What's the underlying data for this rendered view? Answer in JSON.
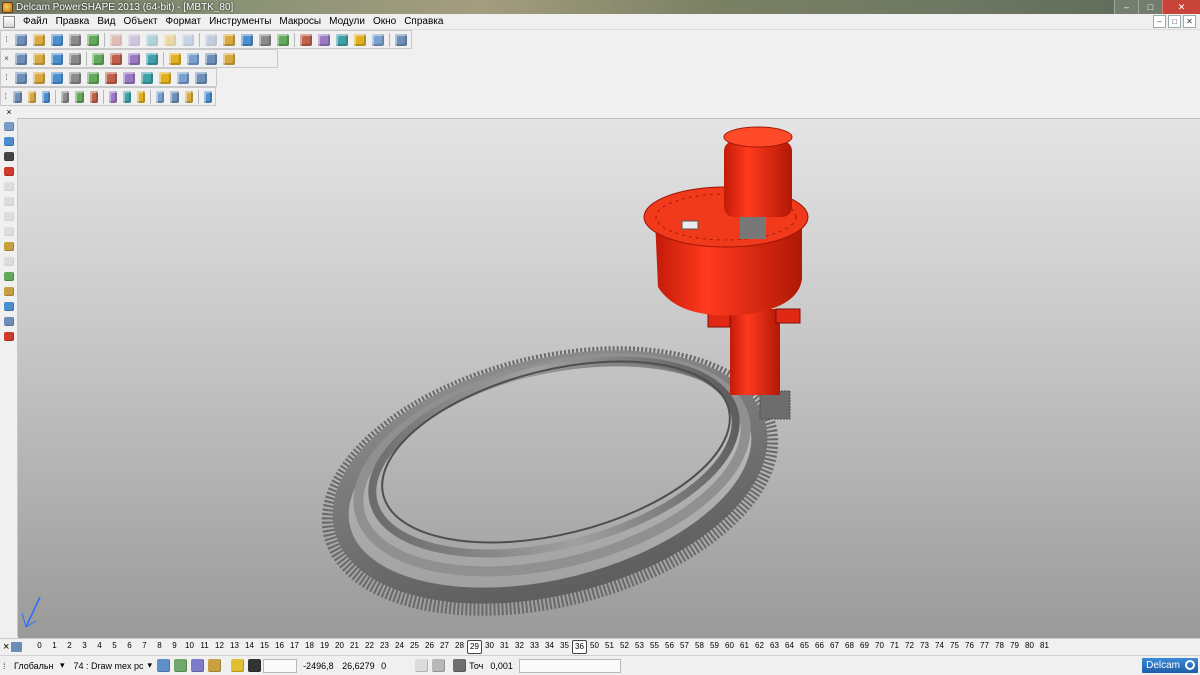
{
  "window": {
    "title": "Delcam PowerSHAPE 2013 (64-bit) - [MBTK_80]",
    "buttons": [
      "–",
      "□",
      "✕"
    ]
  },
  "menu": {
    "items": [
      "Файл",
      "Правка",
      "Вид",
      "Объект",
      "Формат",
      "Инструменты",
      "Макросы",
      "Модули",
      "Окно",
      "Справка"
    ],
    "mdi_buttons": [
      "–",
      "□",
      "✕"
    ]
  },
  "toolbars": {
    "close_glyph": "×",
    "row1_icons": [
      "new-icon",
      "open-icon",
      "save-icon",
      "save-as-icon",
      "print-icon",
      "cut-icon",
      "copy-icon",
      "paste-icon",
      "delete-icon",
      "undo-icon",
      "redo-icon",
      "measure-icon",
      "snap-icon",
      "axis-icon",
      "circle-icon",
      "arc-icon",
      "text-icon",
      "curve-icon",
      "surface-icon",
      "solid-icon",
      "tool-icon"
    ],
    "row2_icons": [
      "view-iso-icon",
      "view-front-icon",
      "view-top-icon",
      "view-3d-icon",
      "zoom-box-icon",
      "zoom-in-icon",
      "zoom-fit-icon",
      "rotate-icon",
      "pan-icon",
      "shade-icon",
      "light-icon",
      "hand-icon"
    ],
    "row3_icons": [
      "wireframe-icon",
      "surface-model-icon",
      "blue-solid-icon",
      "green-solid-icon",
      "red-solid-icon",
      "cone-icon",
      "cube-icon",
      "box-icon",
      "frame-icon",
      "cylinder-icon",
      "sphere-icon"
    ],
    "row4_icons": [
      "edit-icon",
      "transform-icon",
      "feature-icon",
      "pocket-icon",
      "boss-icon",
      "shell-icon",
      "blend-icon",
      "pattern-icon",
      "morph-icon",
      "split-icon",
      "draft-icon",
      "fillet-icon",
      "chamfer-icon"
    ]
  },
  "left_toolbar": {
    "icons": [
      "select-icon",
      "model-tree-icon",
      "point-icon",
      "warning-icon",
      "line-icon",
      "arc-tool-icon",
      "curve-tool-icon",
      "surface-tool-icon",
      "star-icon",
      "cone-tool-icon",
      "solid-tool-icon",
      "gear-icon",
      "assembly-icon",
      "layer-icon",
      "red-tool-icon"
    ]
  },
  "levels": {
    "numbers": [
      "0",
      "1",
      "2",
      "3",
      "4",
      "5",
      "6",
      "7",
      "8",
      "9",
      "10",
      "11",
      "12",
      "13",
      "14",
      "15",
      "16",
      "17",
      "18",
      "19",
      "20",
      "21",
      "22",
      "23",
      "24",
      "25",
      "26",
      "27",
      "28",
      "29",
      "30",
      "31",
      "32",
      "33",
      "34",
      "35",
      "36",
      "50",
      "51",
      "52",
      "53",
      "55",
      "56",
      "57",
      "58",
      "59",
      "60",
      "61",
      "62",
      "63",
      "64",
      "65",
      "66",
      "67",
      "68",
      "69",
      "70",
      "71",
      "72",
      "73",
      "74",
      "75",
      "76",
      "77",
      "78",
      "79",
      "80",
      "81"
    ],
    "active": [
      "29",
      "36"
    ]
  },
  "status": {
    "workplane": "Глобальн",
    "level": "74 : Draw mex pc",
    "x": "-2496,8",
    "y": "26,6279",
    "z": "0",
    "tolerance_label": "Точ",
    "tolerance": "0,001",
    "logo": "Delcam"
  },
  "colors": {
    "accent_red": "#e8220f",
    "gear_grey": "#7a7a7a",
    "background_top": "#e4e4e4",
    "background_bottom": "#9a9a9a"
  }
}
